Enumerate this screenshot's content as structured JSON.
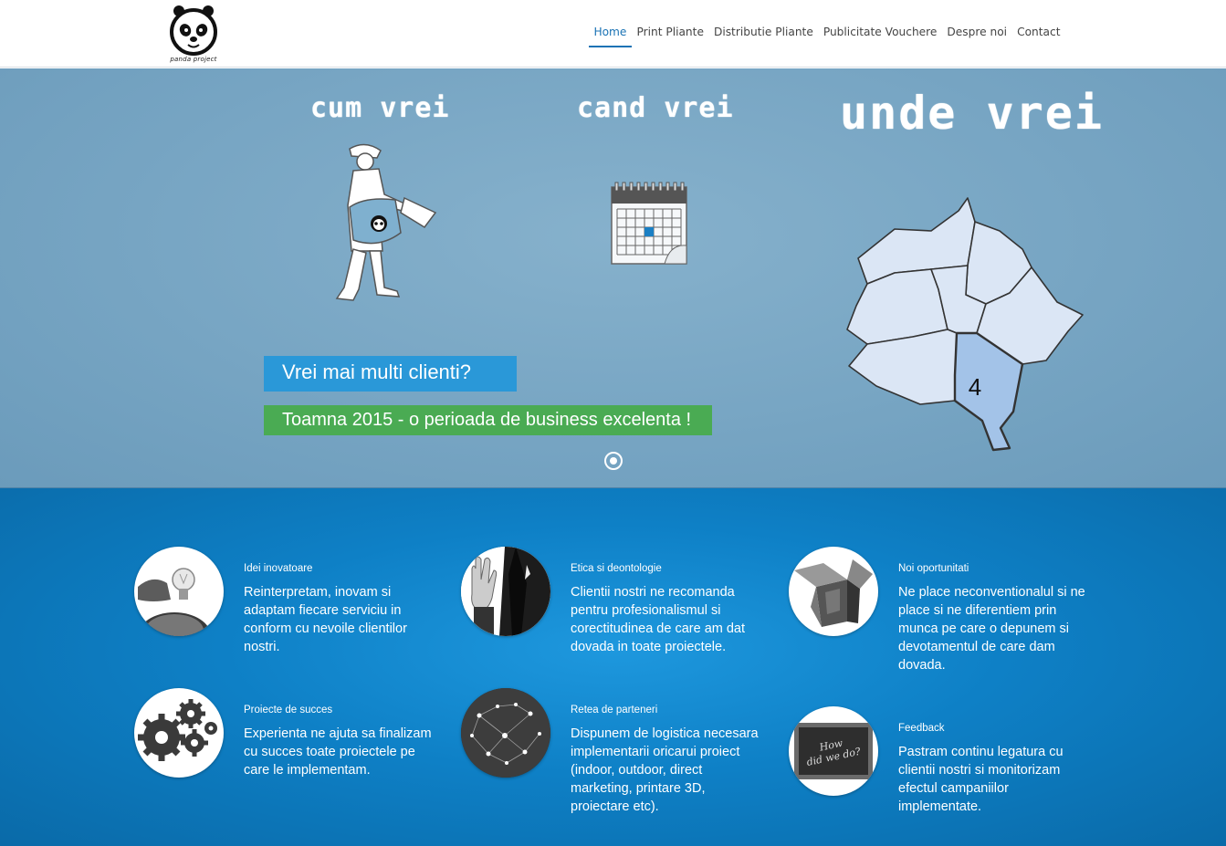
{
  "logo": {
    "text": "panda project"
  },
  "nav": {
    "items": [
      "Home",
      "Print Pliante",
      "Distributie Pliante",
      "Publicitate Vouchere",
      "Despre noi",
      "Contact"
    ]
  },
  "hero": {
    "title1": "cum vrei",
    "title2": "cand vrei",
    "title3": "unde vrei",
    "banner_question": "Vrei mai multi clienti?",
    "banner_slogan": "Toamna 2015 - o perioada de business excelenta !",
    "map_label": "4",
    "colors": {
      "question_bg": "#2a98d8",
      "slogan_bg": "#4aab53"
    }
  },
  "features": [
    {
      "icon": "lightbulb-icon",
      "title": "Idei inovatoare",
      "text": "Reinterpretam, inovam si adaptam fiecare serviciu in conform cu nevoile clientilor nostri."
    },
    {
      "icon": "hand-oath-icon",
      "title": "Etica si deontologie",
      "text": "Clientii nostri ne recomanda pentru profesionalismul si corectitudinea de care am dat dovada in toate proiectele."
    },
    {
      "icon": "open-box-icon",
      "title": "Noi oportunitati",
      "text": "Ne place neconventionalul si ne place si ne diferentiem prin munca pe care o depunem si devotamentul de care dam dovada."
    },
    {
      "icon": "gears-icon",
      "title": "Proiecte de succes",
      "text": "Experienta ne ajuta sa finalizam cu succes toate proiectele pe care le implementam."
    },
    {
      "icon": "network-icon",
      "title": "Retea de parteneri",
      "text": "Dispunem de logistica necesara implementarii oricarui proiect (indoor, outdoor, direct marketing, printare 3D, proiectare etc)."
    },
    {
      "icon": "chalkboard-icon",
      "title": "Feedback",
      "text": "Pastram continu legatura cu clientii nostri si monitorizam efectul campaniilor implementate.",
      "board_text": "How did we do?"
    }
  ]
}
